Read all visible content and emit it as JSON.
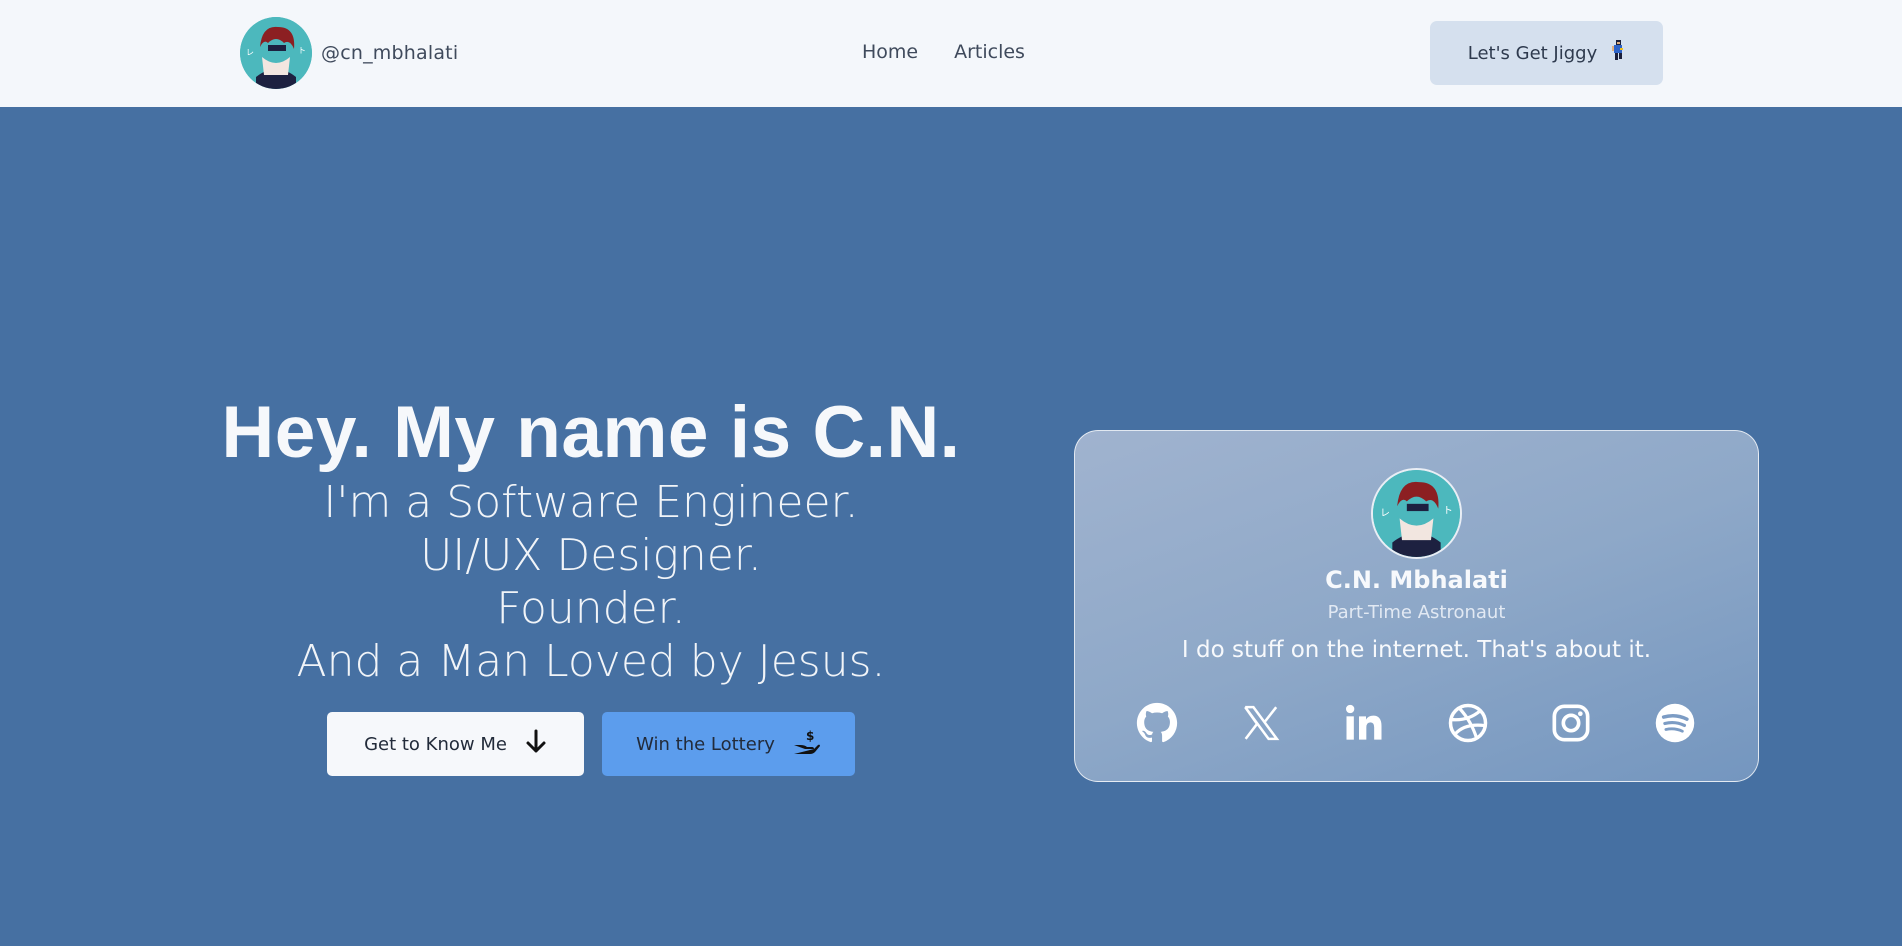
{
  "header": {
    "handle": "@cn_mbhalati",
    "nav": [
      {
        "label": "Home"
      },
      {
        "label": "Articles"
      }
    ],
    "cta_label": "Let's Get Jiggy"
  },
  "hero": {
    "title": "Hey. My name is C.N.",
    "lines": [
      "I'm a Software Engineer.",
      "UI/UX Designer.",
      "Founder.",
      "And a Man Loved by Jesus."
    ],
    "buttons": {
      "know_me": "Get to Know Me",
      "lottery": "Win the Lottery"
    }
  },
  "card": {
    "name": "C.N. Mbhalati",
    "role": "Part-Time Astronaut",
    "bio": "I do stuff on the internet. That's about it.",
    "socials": [
      "github-icon",
      "x-icon",
      "linkedin-icon",
      "dribbble-icon",
      "instagram-icon",
      "spotify-icon"
    ]
  },
  "colors": {
    "background": "#4670a2",
    "topbar": "#f4f7fb",
    "accent_button": "#5c9ded",
    "avatar_bg": "#4cb8bd"
  }
}
